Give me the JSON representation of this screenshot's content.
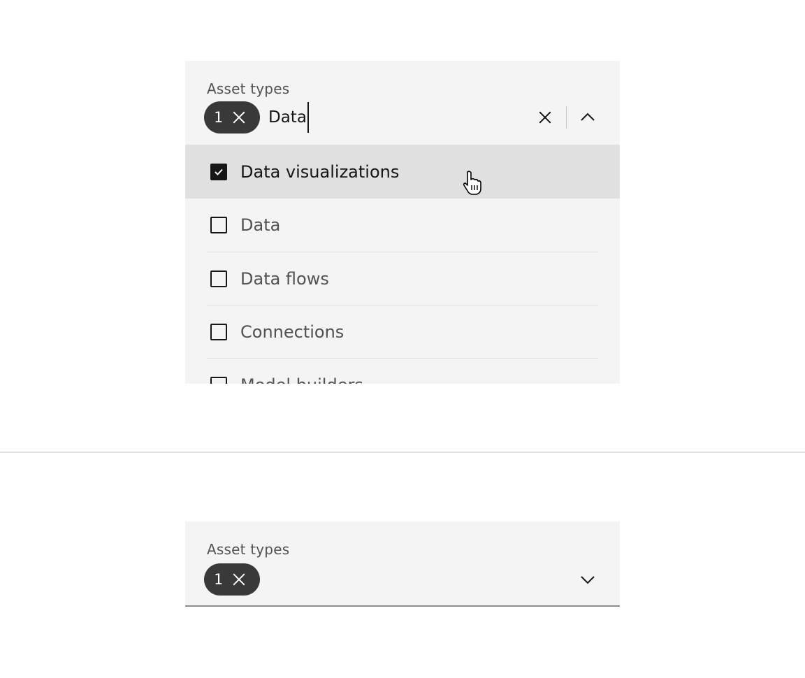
{
  "open_combobox": {
    "label": "Asset types",
    "selected_count": "1",
    "query": "Data",
    "expanded": true,
    "options": [
      {
        "label": "Data visualizations",
        "checked": true,
        "hovered": true
      },
      {
        "label": "Data",
        "checked": false
      },
      {
        "label": "Data flows",
        "checked": false
      },
      {
        "label": "Connections",
        "checked": false
      },
      {
        "label": "Model builders",
        "checked": false
      }
    ],
    "icons": {
      "tag_remove": "close-icon",
      "clear": "close-icon",
      "toggle": "chevron-up-icon"
    }
  },
  "closed_combobox": {
    "label": "Asset types",
    "selected_count": "1",
    "expanded": false,
    "icons": {
      "tag_remove": "close-icon",
      "toggle": "chevron-down-icon"
    }
  },
  "colors": {
    "field_bg": "#f4f4f4",
    "hover_bg": "#e0e0e0",
    "tag_bg": "#393939",
    "text_primary": "#161616",
    "text_secondary": "#525252",
    "divider": "#e0e0e0",
    "bottom_border": "#8d8d8d"
  }
}
